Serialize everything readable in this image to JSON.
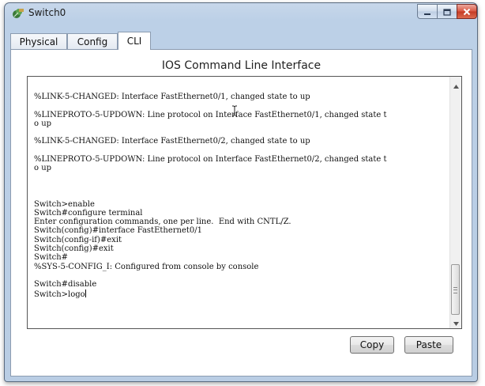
{
  "window": {
    "title": "Switch0",
    "icon": "switch-device-icon",
    "controls": {
      "minimize": "minimize-icon",
      "maximize": "maximize-icon",
      "close": "close-icon"
    }
  },
  "tabs": [
    {
      "label": "Physical",
      "active": false
    },
    {
      "label": "Config",
      "active": false
    },
    {
      "label": "CLI",
      "active": true
    }
  ],
  "cli": {
    "heading": "IOS Command Line Interface",
    "lines": [
      "%LINK-5-CHANGED: Interface FastEthernet0/1, changed state to up",
      "",
      "%LINEPROTO-5-UPDOWN: Line protocol on Interface FastEthernet0/1, changed state t",
      "o up",
      "",
      "%LINK-5-CHANGED: Interface FastEthernet0/2, changed state to up",
      "",
      "%LINEPROTO-5-UPDOWN: Line protocol on Interface FastEthernet0/2, changed state t",
      "o up",
      "",
      "",
      "",
      "Switch>enable",
      "Switch#configure terminal",
      "Enter configuration commands, one per line.  End with CNTL/Z.",
      "Switch(config)#interface FastEthernet0/1",
      "Switch(config-if)#exit",
      "Switch(config)#exit",
      "Switch#",
      "%SYS-5-CONFIG_I: Configured from console by console",
      "",
      "Switch#disable"
    ],
    "current_input": "Switch>logo"
  },
  "buttons": {
    "copy": "Copy",
    "paste": "Paste"
  },
  "colors": {
    "window_frame": "#bcd0e7",
    "close_button": "#c43a24"
  }
}
